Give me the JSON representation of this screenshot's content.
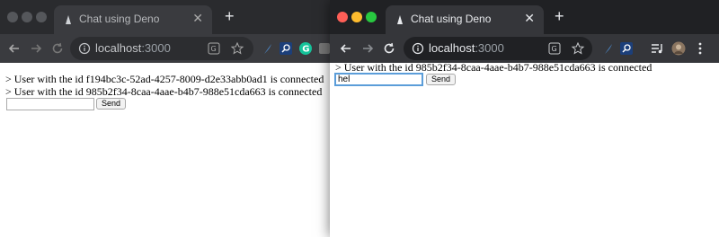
{
  "back_window": {
    "tab_title": "Chat using Deno",
    "url_host": "localhost",
    "url_port": ":3000",
    "messages": [
      "> User with the id f194bc3c-52ad-4257-8009-d2e33abb0ad1 is connected",
      "> User with the id 985b2f34-8caa-4aae-b4b7-988e51cda663 is connected"
    ],
    "input_value": "",
    "send_label": "Send"
  },
  "front_window": {
    "tab_title": "Chat using Deno",
    "url_host": "localhost",
    "url_port": ":3000",
    "messages": [
      "> User with the id 985b2f34-8caa-4aae-b4b7-988e51cda663 is connected"
    ],
    "input_value": "hel",
    "send_label": "Send"
  },
  "colors": {
    "focus_ring": "#5b9dd9",
    "toolbar_dark": "#35363a",
    "titlebar_dark": "#202124"
  }
}
